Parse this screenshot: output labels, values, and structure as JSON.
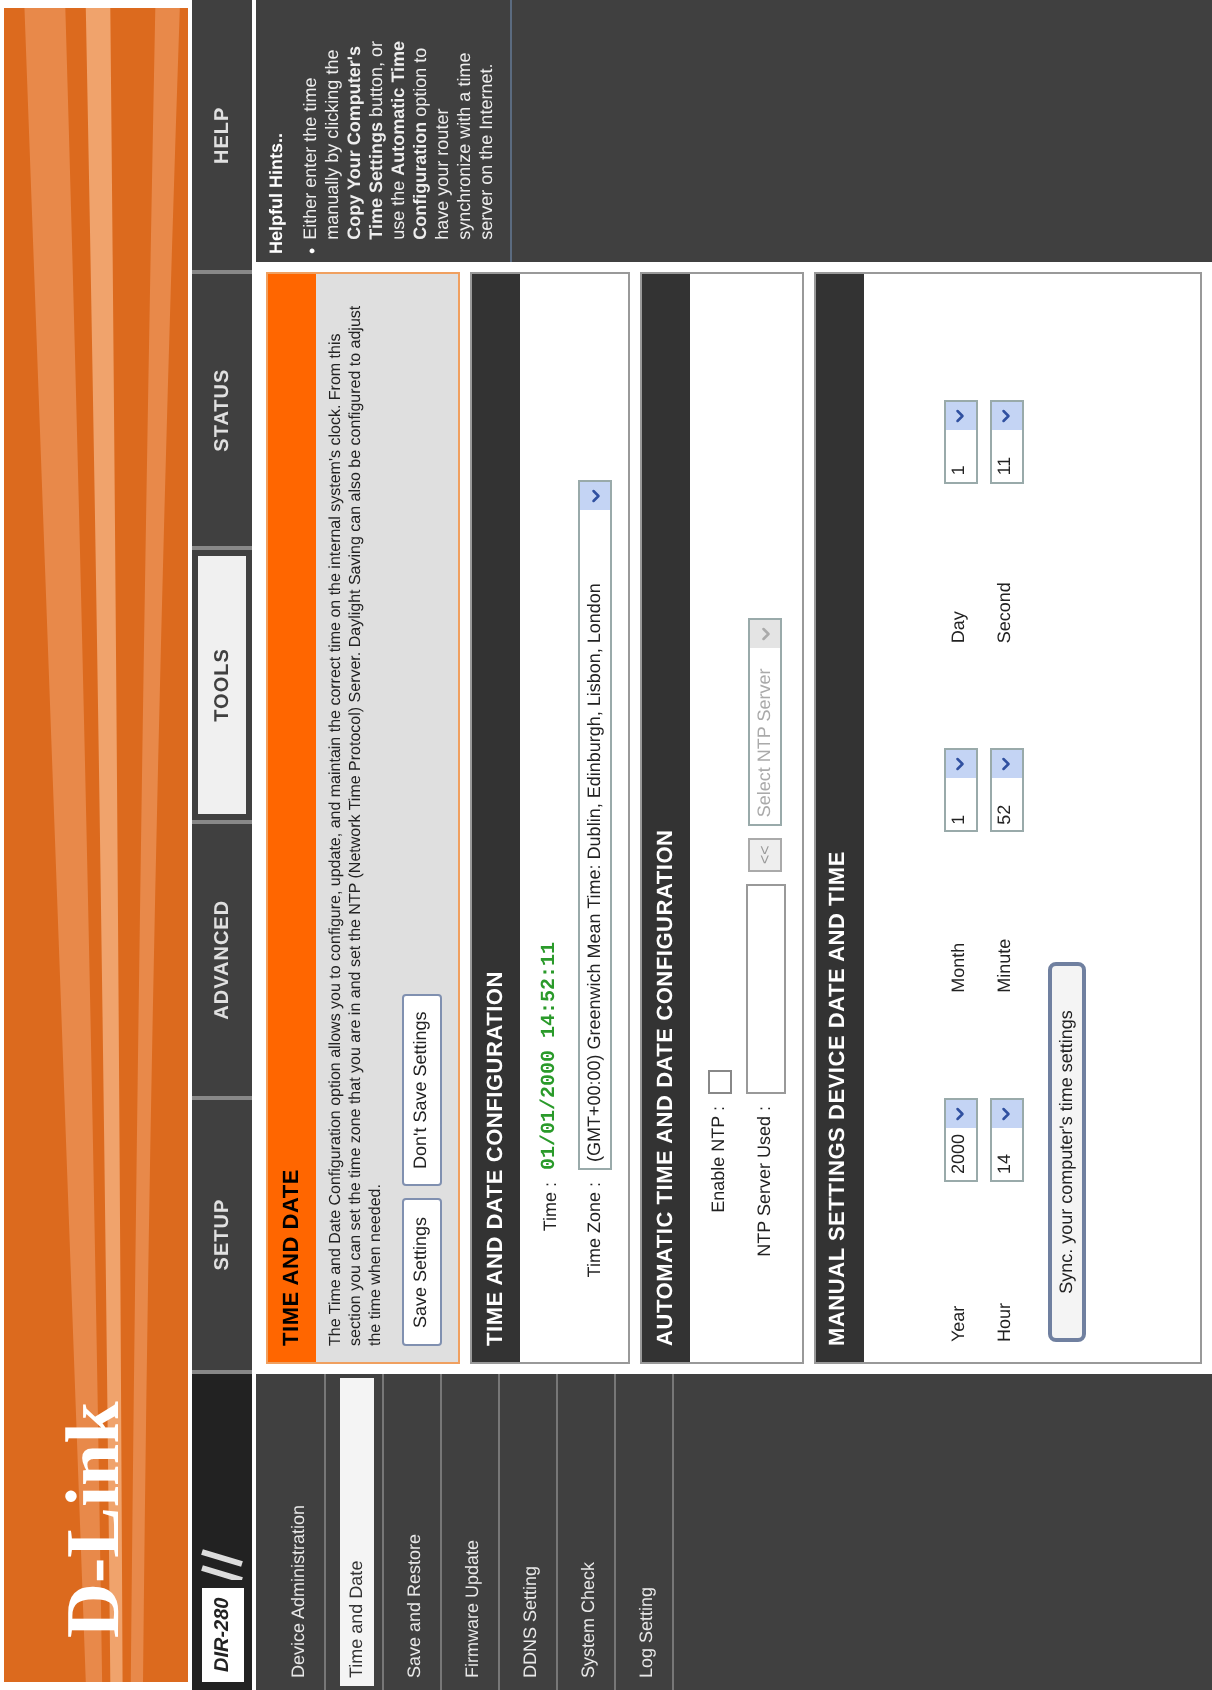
{
  "header": {
    "logo": "D-Link"
  },
  "nav": {
    "model": "DIR-280",
    "tabs": [
      {
        "label": "SETUP",
        "selected": false
      },
      {
        "label": "ADVANCED",
        "selected": false
      },
      {
        "label": "TOOLS",
        "selected": true
      },
      {
        "label": "STATUS",
        "selected": false
      },
      {
        "label": "HELP",
        "selected": false
      }
    ]
  },
  "sidebar": {
    "items": [
      {
        "label": "Device Administration",
        "selected": false
      },
      {
        "label": "Time and Date",
        "selected": true
      },
      {
        "label": "Save and Restore",
        "selected": false
      },
      {
        "label": "Firmware Update",
        "selected": false
      },
      {
        "label": "DDNS Setting",
        "selected": false
      },
      {
        "label": "System Check",
        "selected": false
      },
      {
        "label": "Log Setting",
        "selected": false
      }
    ]
  },
  "intro": {
    "title": "TIME AND DATE",
    "text": "The Time and Date Configuration option allows you to configure, update, and maintain the correct time on the internal system's clock. From this section you can set the time zone that you are in and set the NTP (Network Time Protocol) Server. Daylight Saving can also be configured to adjust the time when needed.",
    "buttons": [
      "Save Settings",
      "Don't Save Settings"
    ]
  },
  "time_config": {
    "title": "TIME AND DATE CONFIGURATION",
    "time_label": "Time :",
    "time": "01/01/2000 14:52:11",
    "zone_label": "Time Zone :",
    "zone": "(GMT+00:00) Greenwich Mean Time: Dublin, Edinburgh, Lisbon, London"
  },
  "automatic": {
    "title": "AUTOMATIC TIME AND DATE CONFIGURATION",
    "enable_label": "Enable NTP :",
    "enable_checked": false,
    "server_label": "NTP Server Used :",
    "copy_button": "<<",
    "server_select": {
      "value": "Select NTP Server",
      "disabled": true
    }
  },
  "manual": {
    "title": "MANUAL SETTINGS DEVICE DATE AND TIME",
    "fields": [
      {
        "label": "Year",
        "value": "2000"
      },
      {
        "label": "Month",
        "value": "1"
      },
      {
        "label": "Day",
        "value": "1"
      },
      {
        "label": "Hour",
        "value": "14"
      },
      {
        "label": "Minute",
        "value": "52"
      },
      {
        "label": "Second",
        "value": "11"
      }
    ],
    "sync_button": "Sync. your computer's time settings"
  },
  "help": {
    "title": "Helpful Hints..",
    "bullet": "•",
    "text": "Either enter the time manually by clicking the **Copy Your Computer's Time Settings** button, or use the **Automatic Time Configuration** option to have your router synchronize with a time server on the Internet."
  }
}
